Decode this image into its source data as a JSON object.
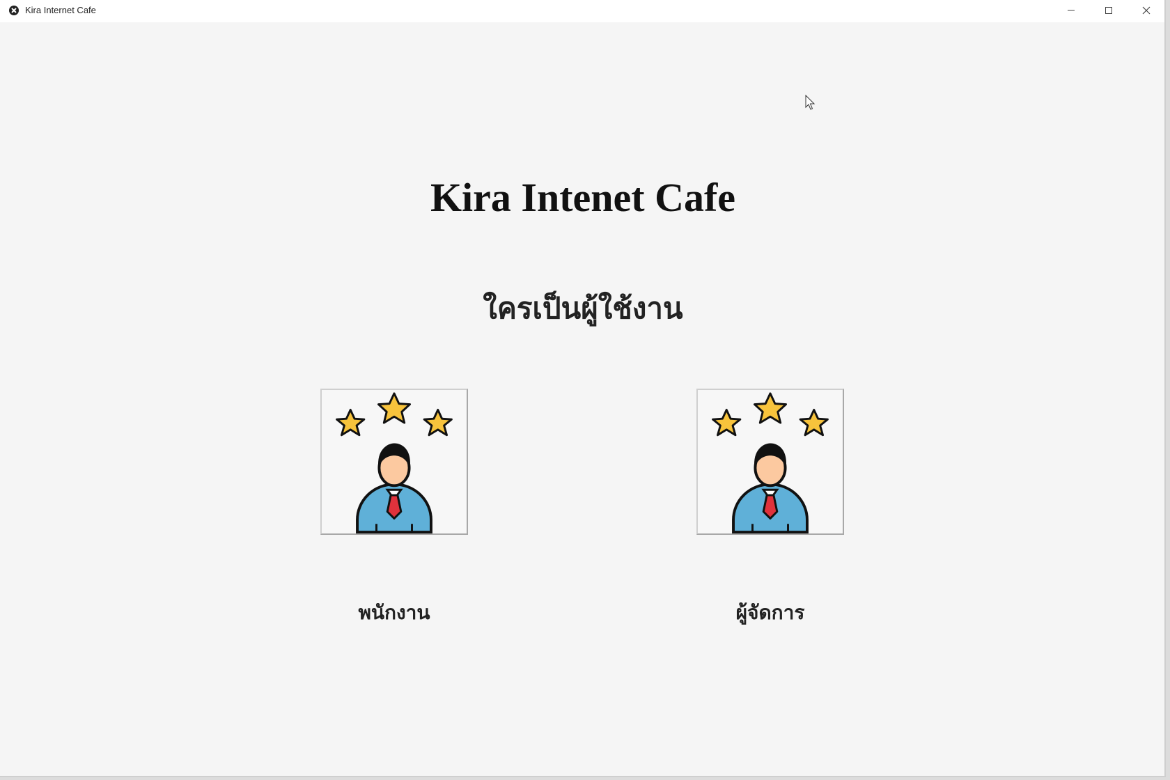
{
  "window": {
    "title": "Kira Internet Cafe"
  },
  "main": {
    "title": "Kira Intenet Cafe",
    "prompt": "ใครเป็นผู้ใช้งาน"
  },
  "roles": [
    {
      "label": "พนักงาน",
      "icon": "employee-stars-icon"
    },
    {
      "label": "ผู้จัดการ",
      "icon": "employee-stars-icon"
    }
  ],
  "colors": {
    "background": "#f5f5f5",
    "star": "#f7c33c",
    "shirt": "#5fb0d8",
    "tie": "#e0323c",
    "skin": "#fcc9a0",
    "hair": "#111111"
  }
}
